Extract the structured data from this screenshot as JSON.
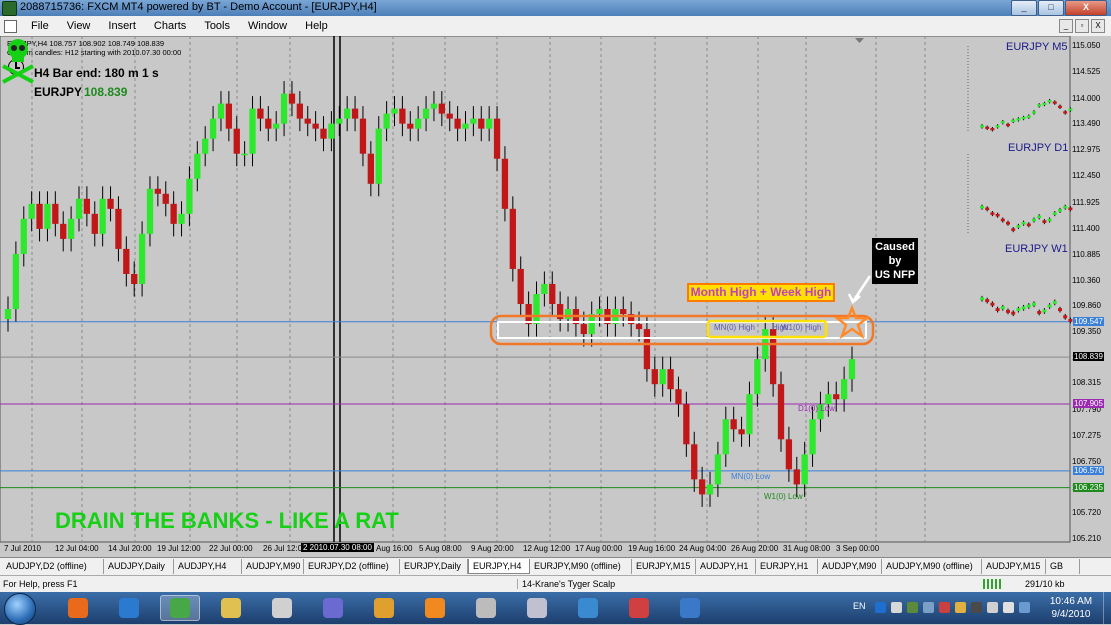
{
  "window": {
    "title": "2088715736: FXCM MT4 powered by BT - Demo Account - [EURJPY,H4]",
    "controls": [
      "_",
      "□",
      "X"
    ]
  },
  "menu": [
    "File",
    "View",
    "Insert",
    "Charts",
    "Tools",
    "Window",
    "Help"
  ],
  "mdi_controls": [
    "_",
    "▫",
    "X"
  ],
  "chart": {
    "info_line1": "EURJPY,H4  108.757 108.902 108.749 108.839",
    "info_line2": "Custom candles: H12 starting with 2010.07.30 00:00",
    "bar_end": "H4 Bar end: 180 m 1 s",
    "symbol": "EURJPY",
    "symbol_price": "108.839",
    "callout_nfp": [
      "Caused",
      "by",
      "US NFP"
    ],
    "callout_high": "Month High + Week High",
    "label_mn_high": "MN(0) High",
    "label_high_mid": "High",
    "label_w_high": "W1(0) High",
    "label_mn_low": "MN(0) Low",
    "label_w_low": "W1(0) Low",
    "label_d_low": "D1(0) Low",
    "drain_text": "DRAIN THE BANKS - LIKE A RAT",
    "mini_charts": [
      "EURJPY  M5",
      "EURJPY  D1",
      "EURJPY  W1"
    ],
    "price_axis": [
      "115.050",
      "114.525",
      "114.000",
      "113.490",
      "112.975",
      "112.450",
      "111.925",
      "111.400",
      "110.885",
      "110.360",
      "109.860",
      "109.350",
      "108.830",
      "108.315",
      "107.790",
      "107.275",
      "106.750",
      "106.235",
      "105.720",
      "105.210"
    ],
    "price_markers": {
      "current": "108.839",
      "blue_upper": "109.547",
      "purple": "107.905",
      "blue_lower": "106.570",
      "green": "106.235"
    },
    "time_axis": [
      "7 Jul 2010",
      "12 Jul 04:00",
      "14 Jul 20:00",
      "19 Jul 12:00",
      "22 Jul 00:00",
      "26 Jul 12:00",
      "2 2010.07.30 08:00",
      "Aug 16:00",
      "5 Aug 08:00",
      "9 Aug 20:00",
      "12 Aug 12:00",
      "17 Aug 00:00",
      "19 Aug 16:00",
      "24 Aug 04:00",
      "26 Aug 20:00",
      "31 Aug 08:00",
      "3 Sep 00:00"
    ],
    "colors": {
      "background": "#c8c8c8",
      "bull": "#2ee82e",
      "bear": "#c01818",
      "blue_line": "#3a7fd9",
      "purple_line": "#9a2ab0",
      "green_line": "#1e8a1e",
      "grid": "#8a8a8a"
    }
  },
  "tabs": [
    "AUDJPY,D2 (offline)",
    "AUDJPY,Daily",
    "AUDJPY,H4",
    "AUDJPY,M90",
    "EURJPY,D2 (offline)",
    "EURJPY,Daily",
    "EURJPY,H4",
    "EURJPY,M90 (offline)",
    "EURJPY,M15",
    "AUDJPY,H1",
    "EURJPY,H1",
    "AUDJPY,M90",
    "AUDJPY,M90 (offline)",
    "AUDJPY,M15",
    "GB"
  ],
  "active_tab": "EURJPY,H4",
  "status": {
    "help": "For Help, press F1",
    "template": "14-Krane's Tyger Scalp",
    "kb": "291/10 kb"
  },
  "taskbar": {
    "lang": "EN",
    "time": "10:46 AM",
    "date": "9/4/2010",
    "apps": [
      "firefox-icon",
      "app2-icon",
      "metatrader-icon",
      "explorer-icon",
      "media-icon",
      "paint-icon",
      "folder-icon",
      "orb-icon",
      "calculator-icon",
      "palette-icon",
      "itunes-icon",
      "tool-icon",
      "thunderbird-icon"
    ]
  }
}
